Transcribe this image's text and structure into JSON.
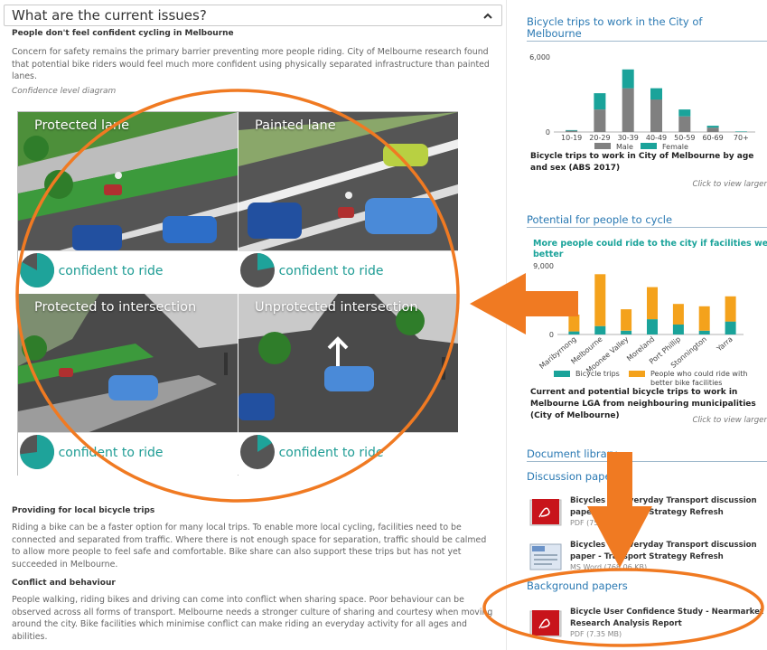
{
  "accordion": {
    "title": "What are the current issues?"
  },
  "section1": {
    "heading": "People don't feel confident cycling in Melbourne",
    "body": "Concern for safety remains the primary barrier preventing more people riding. City of Melbourne research found that potential bike riders would feel much more confident using physically separated infrastructure than painted lanes.",
    "caption": "Confidence level diagram"
  },
  "diagram": [
    {
      "title": "Protected lane",
      "confidence": "83% confident to ride",
      "share": 0.83
    },
    {
      "title": "Painted lane",
      "confidence": "22% confident to ride",
      "share": 0.22
    },
    {
      "title": "Protected to intersection",
      "confidence": "73% confident to ride",
      "share": 0.73
    },
    {
      "title": "Unprotected intersection",
      "confidence": "16% confident to ride",
      "share": 0.16
    }
  ],
  "section2": {
    "heading": "Providing for local bicycle trips",
    "body": "Riding a bike can be a faster option for many local trips. To enable more local cycling, facilities need to be connected and separated from traffic. Where there is not enough space for separation, traffic should be calmed to allow more people to feel safe and comfortable. Bike share can also support these trips but has not yet succeeded in Melbourne."
  },
  "section3": {
    "heading": "Conflict and behaviour",
    "body": "People walking, riding bikes and driving can come into conflict when sharing space. Poor behaviour can be observed across all forms of transport. Melbourne needs a stronger culture of sharing and courtesy when moving around the city. Bike facilities which minimise conflict can make riding an everyday activity for all ages and abilities."
  },
  "sidebar": {
    "chart1_heading": "Bicycle trips to work in the City of Melbourne",
    "chart1_caption": "Bicycle trips to work in City of Melbourne by age and sex (ABS 2017)",
    "chart1_click": "Click to view larger",
    "chart2_heading": "Potential for people to cycle",
    "chart2_caption": "Current and potential bicycle trips to work in Melbourne LGA from neighbouring municipalities (City of Melbourne)",
    "chart2_click": "Click to view larger",
    "doclib_heading": "Document library",
    "discussion_heading": "Discussion papers",
    "background_heading": "Background papers",
    "docs": [
      {
        "title": "Bicycles for Everyday Transport discussion paper - Transport Strategy Refresh",
        "meta": "PDF (755.47 KB)",
        "icon": "pdf-icon"
      },
      {
        "title": "Bicycles for Everyday Transport discussion paper - Transport Strategy Refresh",
        "meta": "MS Word (768.06 KB)",
        "icon": "word-icon"
      },
      {
        "title": "Bicycle User Confidence Study - Nearmarket Research Analysis Report",
        "meta": "PDF (7.35 MB)",
        "icon": "pdf-icon"
      }
    ]
  },
  "chart_data": [
    {
      "type": "bar",
      "stacked": true,
      "categories": [
        "10-19",
        "20-29",
        "30-39",
        "40-49",
        "50-59",
        "60-69",
        "70+"
      ],
      "series": [
        {
          "name": "Male",
          "values": [
            100,
            1800,
            3500,
            2600,
            1250,
            350,
            30
          ],
          "color": "#808080"
        },
        {
          "name": "Female",
          "values": [
            50,
            1300,
            1500,
            900,
            550,
            150,
            10
          ],
          "color": "#1aa39a"
        }
      ],
      "ylim": [
        0,
        6000
      ],
      "yticks": [
        "0",
        "6,000"
      ],
      "legend": "bottom"
    },
    {
      "type": "bar",
      "stacked": true,
      "title": "More people could ride to the city if facilities were better",
      "categories": [
        "Maribyrnong",
        "Melbourne",
        "Moonee Valley",
        "Moreland",
        "Port Phillip",
        "Stonnington",
        "Yarra"
      ],
      "series": [
        {
          "name": "Bicycle trips",
          "values": [
            400,
            1100,
            500,
            2000,
            1300,
            500,
            1700
          ],
          "color": "#1aa39a"
        },
        {
          "name": "People who could ride with better bike facilities",
          "values": [
            2200,
            6800,
            2800,
            4200,
            2700,
            3200,
            3300
          ],
          "color": "#f4a21c"
        }
      ],
      "ylim": [
        0,
        9000
      ],
      "yticks": [
        "0",
        "9,000"
      ],
      "legend": "bottom"
    }
  ]
}
